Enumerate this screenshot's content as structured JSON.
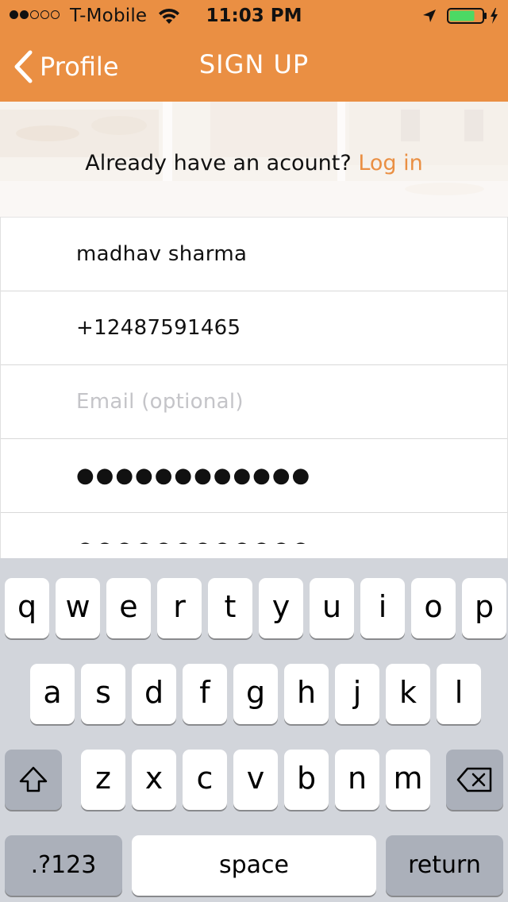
{
  "status_bar": {
    "carrier": "T-Mobile",
    "time": "11:03 PM",
    "signal_bars_filled": 2,
    "signal_bars_total": 5,
    "battery_level": 0.75,
    "icons": [
      "signal-dots-icon",
      "wifi-icon",
      "location-arrow-icon",
      "battery-icon",
      "charging-bolt-icon"
    ]
  },
  "nav": {
    "back_label": "Profile",
    "title": "SIGN UP"
  },
  "banner": {
    "prompt": "Already have an acount?",
    "login_link": "Log in"
  },
  "form": {
    "fields": [
      {
        "name": "full-name",
        "value": "madhav sharma",
        "placeholder": ""
      },
      {
        "name": "phone",
        "value": "+12487591465",
        "placeholder": ""
      },
      {
        "name": "email",
        "value": "",
        "placeholder": "Email (optional)"
      },
      {
        "name": "password",
        "value": "●●●●●●●●●●●●",
        "placeholder": ""
      },
      {
        "name": "confirm-password",
        "value": "●●●●●●●●●●●●",
        "placeholder": ""
      }
    ]
  },
  "keyboard": {
    "row1": [
      "q",
      "w",
      "e",
      "r",
      "t",
      "y",
      "u",
      "i",
      "o",
      "p"
    ],
    "row2": [
      "a",
      "s",
      "d",
      "f",
      "g",
      "h",
      "j",
      "k",
      "l"
    ],
    "row3": [
      "z",
      "x",
      "c",
      "v",
      "b",
      "n",
      "m"
    ],
    "numbers_key": ".?123",
    "space_key": "space",
    "return_key": "return",
    "icons": [
      "shift-icon",
      "backspace-icon"
    ]
  },
  "colors": {
    "accent": "#ea8f43",
    "keyboard_bg": "#d2d5db",
    "special_key": "#abb0ba",
    "placeholder": "#c4c4c8"
  }
}
